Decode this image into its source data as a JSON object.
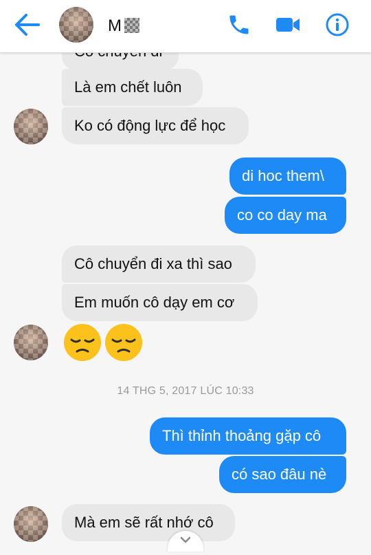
{
  "colors": {
    "accent": "#1e8af6",
    "incoming_bubble": "#e8e8e8",
    "background": "#f6f6f6",
    "timestamp": "#9a9a9a"
  },
  "header": {
    "contact_name": "M",
    "icons": [
      "back-arrow-icon",
      "phone-icon",
      "video-camera-icon",
      "info-icon"
    ]
  },
  "messages": {
    "m0": "Cô chuyển đi",
    "m1": "Là em chết luôn",
    "m2": "Ko có động lực để học",
    "m3": "di hoc them\\",
    "m4": "co co day ma",
    "m5": "Cô chuyển đi xa thì sao",
    "m6": "Em muốn cô dạy em cơ",
    "m7": "Thì thỉnh thoảng gặp cô",
    "m8": "có sao đâu nè",
    "m9": "Mà em sẽ rất nhớ cô"
  },
  "emoji": [
    "pensive-face-emoji",
    "pensive-face-emoji"
  ],
  "timestamp": "14 THG 5, 2017 LÚC 10:33"
}
